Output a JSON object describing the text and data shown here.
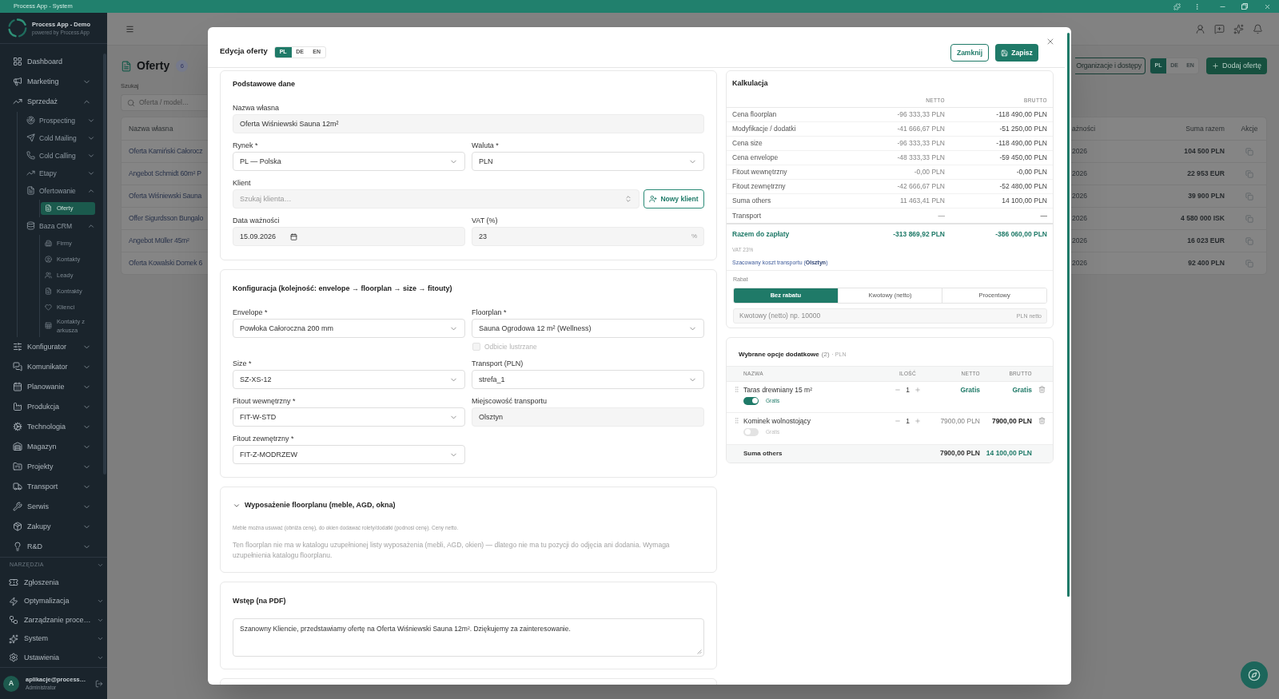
{
  "title_bar": {
    "title": "Process App - System"
  },
  "sidebar": {
    "brand": {
      "name": "Process App - Demo",
      "tagline": "powered by Process App"
    },
    "items": [
      {
        "kind": "link",
        "label": "Dashboard",
        "selected": false
      },
      {
        "kind": "group",
        "label": "Marketing",
        "expanded": false,
        "selected": false
      },
      {
        "kind": "group",
        "label": "Sprzedaż",
        "expanded": true,
        "selected": false,
        "children": [
          {
            "kind": "group",
            "label": "Prospecting",
            "expanded": false,
            "selected": false
          },
          {
            "kind": "group",
            "label": "Cold Mailing",
            "expanded": false,
            "selected": false
          },
          {
            "kind": "group",
            "label": "Cold Calling",
            "expanded": false,
            "selected": false
          },
          {
            "kind": "group",
            "label": "Etapy",
            "expanded": false,
            "selected": false
          },
          {
            "kind": "group",
            "label": "Ofertowanie",
            "expanded": true,
            "selected": false,
            "children": [
              {
                "kind": "link",
                "label": "Oferty",
                "selected": true
              }
            ]
          },
          {
            "kind": "group",
            "label": "Baza CRM",
            "expanded": true,
            "selected": false,
            "children": [
              {
                "kind": "link",
                "label": "Firmy",
                "selected": false
              },
              {
                "kind": "link",
                "label": "Kontakty",
                "selected": false
              },
              {
                "kind": "link",
                "label": "Leady",
                "selected": false
              },
              {
                "kind": "link",
                "label": "Kontrakty",
                "selected": false
              },
              {
                "kind": "link",
                "label": "Klienci",
                "selected": false
              },
              {
                "kind": "link",
                "label": "Kontakty z arkusza",
                "selected": false
              }
            ]
          }
        ]
      },
      {
        "kind": "group",
        "label": "Konfigurator",
        "expanded": false,
        "selected": false
      },
      {
        "kind": "group",
        "label": "Komunikator",
        "expanded": false,
        "selected": false
      },
      {
        "kind": "group",
        "label": "Planowanie",
        "expanded": false,
        "selected": false
      },
      {
        "kind": "group",
        "label": "Produkcja",
        "expanded": false,
        "selected": false
      },
      {
        "kind": "group",
        "label": "Technologia",
        "expanded": false,
        "selected": false
      },
      {
        "kind": "group",
        "label": "Magazyn",
        "expanded": false,
        "selected": false
      },
      {
        "kind": "group",
        "label": "Projekty",
        "expanded": false,
        "selected": false
      },
      {
        "kind": "group",
        "label": "Transport",
        "expanded": false,
        "selected": false
      },
      {
        "kind": "group",
        "label": "Serwis",
        "expanded": false,
        "selected": false
      },
      {
        "kind": "group",
        "label": "Zakupy",
        "expanded": false,
        "selected": false
      },
      {
        "kind": "group",
        "label": "R&D",
        "expanded": false,
        "selected": false
      }
    ],
    "tools": {
      "title": "NARZĘDZIA",
      "items": [
        {
          "kind": "link",
          "label": "Zgłoszenia",
          "selected": false
        },
        {
          "kind": "group",
          "label": "Optymalizacja",
          "expanded": false,
          "selected": false
        },
        {
          "kind": "group",
          "label": "Zarządzanie proce…",
          "expanded": false,
          "selected": false
        },
        {
          "kind": "group",
          "label": "System",
          "expanded": false,
          "selected": false
        },
        {
          "kind": "group",
          "label": "Ustawienia",
          "expanded": false,
          "selected": false
        }
      ]
    },
    "user": {
      "initial": "A",
      "name": "aplikacje@process…",
      "role": "Administrator"
    }
  },
  "page": {
    "title": "Oferty",
    "count": "6",
    "search": {
      "label": "Szukaj",
      "placeholder": "Oferta / model…"
    },
    "org_button": "Organizacje i dostępy",
    "languages": [
      {
        "label": "PL",
        "selected": true
      },
      {
        "label": "DE",
        "selected": false
      },
      {
        "label": "EN",
        "selected": false
      }
    ],
    "add_button": "Dodaj ofertę",
    "table": {
      "columns": [
        "Nazwa własna",
        "ażności",
        "Suma razem",
        "Akcje"
      ],
      "rows": [
        {
          "name": "Oferta Kamiński Całorocz",
          "column_2": "2026",
          "total": "104 500 PLN"
        },
        {
          "name": "Angebot Schmidt 60m² P",
          "column_2": "2026",
          "total": "22 953 EUR"
        },
        {
          "name": "Oferta Wiśniewski Sauna",
          "column_2": "2026",
          "total": "39 900 PLN"
        },
        {
          "name": "Offer Sigurdsson Bungalo",
          "column_2": "2026",
          "total": "4 580 000 ISK"
        },
        {
          "name": "Angebot Müller 45m²",
          "column_2": "2026",
          "total": "16 023 EUR"
        },
        {
          "name": "Oferta Kowalski Domek 6",
          "column_2": "2026",
          "total": "92 400 PLN"
        }
      ]
    }
  },
  "modal": {
    "title": "Edycja oferty",
    "languages": [
      {
        "label": "PL",
        "selected": true
      },
      {
        "label": "DE",
        "selected": false
      },
      {
        "label": "EN",
        "selected": false
      }
    ],
    "close_button": "Zamknij",
    "save_button": "Zapisz",
    "basic": {
      "title": "Podstawowe dane",
      "name": {
        "label": "Nazwa własna",
        "value": "Oferta Wiśniewski Sauna 12m²"
      },
      "market": {
        "label": "Rynek *",
        "value": "PL — Polska"
      },
      "currency": {
        "label": "Waluta *",
        "value": "PLN"
      },
      "client": {
        "label": "Klient",
        "placeholder": "Szukaj klienta…"
      },
      "new_client_button": "Nowy klient",
      "valid_until": {
        "label": "Data ważności",
        "value": "15.09.2026"
      },
      "vat": {
        "label": "VAT (%)",
        "value": "23",
        "suffix": "%"
      }
    },
    "configuration": {
      "title": "Konfiguracja (kolejność: envelope → floorplan → size → fitouty)",
      "fields": [
        {
          "kind": "select",
          "label": "Envelope *",
          "value": "Powłoka Całoroczna 200 mm"
        },
        {
          "kind": "select",
          "label": "Floorplan *",
          "value": "Sauna Ogrodowa 12 m² (Wellness)",
          "option": {
            "label": "Odbicie lustrzane",
            "checked": false,
            "disabled": true
          }
        },
        {
          "kind": "select",
          "label": "Size *",
          "value": "SZ-XS-12"
        },
        {
          "kind": "select",
          "label": "Transport (PLN)",
          "value": "strefa_1"
        },
        {
          "kind": "select",
          "label": "Fitout wewnętrzny *",
          "value": "FIT-W-STD"
        },
        {
          "kind": "input",
          "label": "Miejscowość transportu",
          "value": "Olsztyn"
        },
        {
          "kind": "select",
          "label": "Fitout zewnętrzny *",
          "value": "FIT-Z-MODRZEW"
        }
      ]
    },
    "equipment": {
      "title": "Wyposażenie floorplanu (meble, AGD, okna)",
      "expanded": true,
      "note": "Meble można usuwać (obniża cenę), do okien dodawać rolety/dodatki (podnosi cenę). Ceny netto.",
      "message": "Ten floorplan nie ma w katalogu uzupełnionej listy wyposażenia (mebli, AGD, okien) — dlatego nie ma tu pozycji do odjęcia ani dodania. Wymaga uzupełnienia katalogu floorplanu."
    },
    "intro": {
      "title": "Wstęp (na PDF)",
      "value": "Szanowny Kliencie, przedstawiamy ofertę na Oferta Wiśniewski Sauna 12m². Dziękujemy za zainteresowanie."
    },
    "calculation": {
      "title": "Kalkulacja",
      "columns": [
        "NETTO",
        "BRUTTO"
      ],
      "rows": [
        {
          "label": "Cena floorplan",
          "netto": "-96 333,33 PLN",
          "brutto": "-118 490,00 PLN"
        },
        {
          "label": "Modyfikacje / dodatki",
          "netto": "-41 666,67 PLN",
          "brutto": "-51 250,00 PLN"
        },
        {
          "label": "Cena size",
          "netto": "-96 333,33 PLN",
          "brutto": "-118 490,00 PLN"
        },
        {
          "label": "Cena envelope",
          "netto": "-48 333,33 PLN",
          "brutto": "-59 450,00 PLN"
        },
        {
          "label": "Fitout wewnętrzny",
          "netto": "-0,00 PLN",
          "brutto": "-0,00 PLN"
        },
        {
          "label": "Fitout zewnętrzny",
          "netto": "-42 666,67 PLN",
          "brutto": "-52 480,00 PLN"
        },
        {
          "label": "Suma others",
          "netto": "11 463,41 PLN",
          "brutto": "14 100,00 PLN"
        },
        {
          "label": "Transport",
          "netto": "—",
          "brutto": "—"
        }
      ],
      "total": {
        "label": "Razem do zapłaty",
        "netto": "-313 869,92 PLN",
        "brutto": "-386 060,00 PLN"
      },
      "vat_note": "VAT 23%",
      "transport_note": "Szacowany koszt transportu (**Olsztyn**)",
      "discount": {
        "label": "Rabat",
        "options": [
          {
            "label": "Bez rabatu",
            "selected": true
          },
          {
            "label": "Kwotowy (netto)",
            "selected": false
          },
          {
            "label": "Procentowy",
            "selected": false
          }
        ],
        "placeholder": "Kwotowy (netto) np. 10000",
        "suffix": "PLN netto"
      }
    },
    "options": {
      "title": "Wybrane opcje dodatkowe",
      "count": "(2)",
      "currency": "· PLN",
      "columns": [
        "NAZWA",
        "ILOŚĆ",
        "NETTO",
        "BRUTTO"
      ],
      "rows": [
        {
          "name": "Taras drewniany 15 m²",
          "gratis": true,
          "gratis_label": "Gratis",
          "quantity": "1",
          "netto": "Gratis",
          "brutto": "Gratis"
        },
        {
          "name": "Kominek wolnostojący",
          "gratis": false,
          "gratis_label": "Gratis",
          "quantity": "1",
          "netto": "7900,00 PLN",
          "brutto": "7900,00 PLN"
        }
      ],
      "footer": {
        "label": "Suma others",
        "netto": "7900,00 PLN",
        "brutto": "14 100,00 PLN"
      }
    }
  }
}
